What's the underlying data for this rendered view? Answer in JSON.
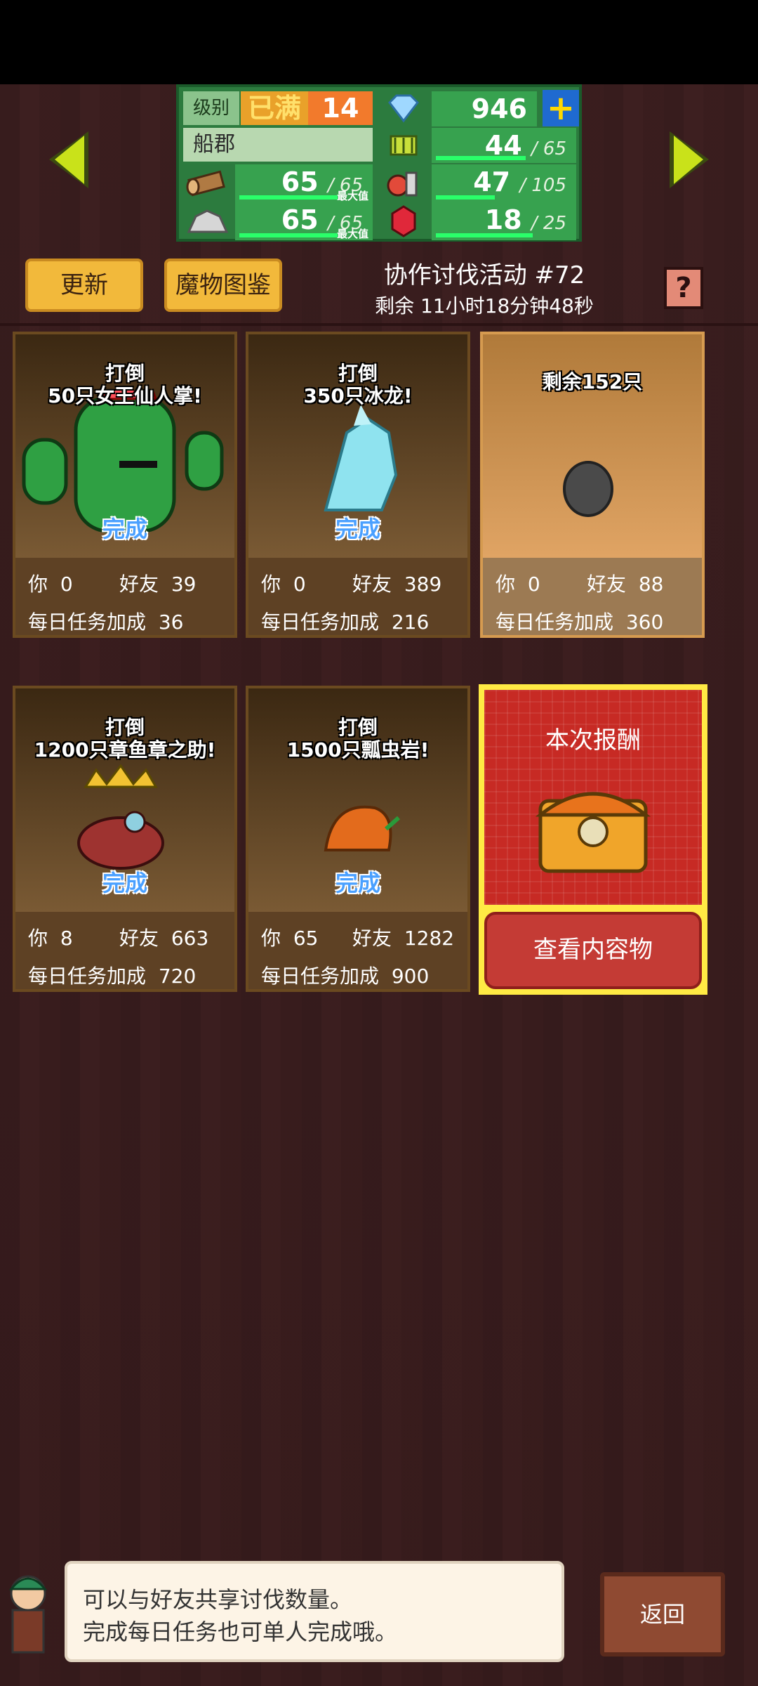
{
  "status": {
    "level_label": "级别",
    "level_full": "已满",
    "level": "14",
    "gems": "946",
    "town_name": "船郡",
    "wood": "65",
    "wood_max": "65",
    "wood_tag": "最大值",
    "grass": "44",
    "grass_max": "65",
    "grass_fill": 0.68,
    "stone": "65",
    "stone_max": "65",
    "stone_tag": "最大值",
    "food": "47",
    "food_max": "105",
    "food_fill": 0.45,
    "ruby": "18",
    "ruby_max": "25",
    "ruby_fill": 0.72,
    "wood_fill": 1.0,
    "stone_fill": 1.0
  },
  "header": {
    "update_button": "更新",
    "monster_book_button": "魔物图鉴",
    "event_title": "协作讨伐活动 #72",
    "event_remaining": "剩余 11小时18分钟48秒",
    "help": "?"
  },
  "cards": [
    {
      "title_line1": "打倒",
      "title_line2": "50只女王仙人掌!",
      "done": "完成",
      "you_label": "你",
      "you": "0",
      "friends_label": "好友",
      "friends": "39",
      "mission_label": "每日任务加成",
      "mission": "36"
    },
    {
      "title_line1": "打倒",
      "title_line2": "350只冰龙!",
      "done": "完成",
      "you_label": "你",
      "you": "0",
      "friends_label": "好友",
      "friends": "389",
      "mission_label": "每日任务加成",
      "mission": "216"
    },
    {
      "title_line1": "剩余152只",
      "title_line2": "",
      "done": "",
      "you_label": "你",
      "you": "0",
      "friends_label": "好友",
      "friends": "88",
      "mission_label": "每日任务加成",
      "mission": "360"
    },
    {
      "title_line1": "打倒",
      "title_line2": "1200只章鱼章之助!",
      "done": "完成",
      "you_label": "你",
      "you": "8",
      "friends_label": "好友",
      "friends": "663",
      "mission_label": "每日任务加成",
      "mission": "720"
    },
    {
      "title_line1": "打倒",
      "title_line2": "1500只瓢虫岩!",
      "done": "完成",
      "you_label": "你",
      "you": "65",
      "friends_label": "好友",
      "friends": "1282",
      "mission_label": "每日任务加成",
      "mission": "900"
    }
  ],
  "reward": {
    "title": "本次报酬",
    "view_button": "查看内容物"
  },
  "tip": {
    "line1": "可以与好友共享讨伐数量。",
    "line2": "完成每日任务也可单人完成哦。"
  },
  "back_button": "返回",
  "colors": {
    "accent_yellow": "#f2b93b",
    "panel_green": "#37a24f",
    "reward_red": "#c72a24"
  }
}
